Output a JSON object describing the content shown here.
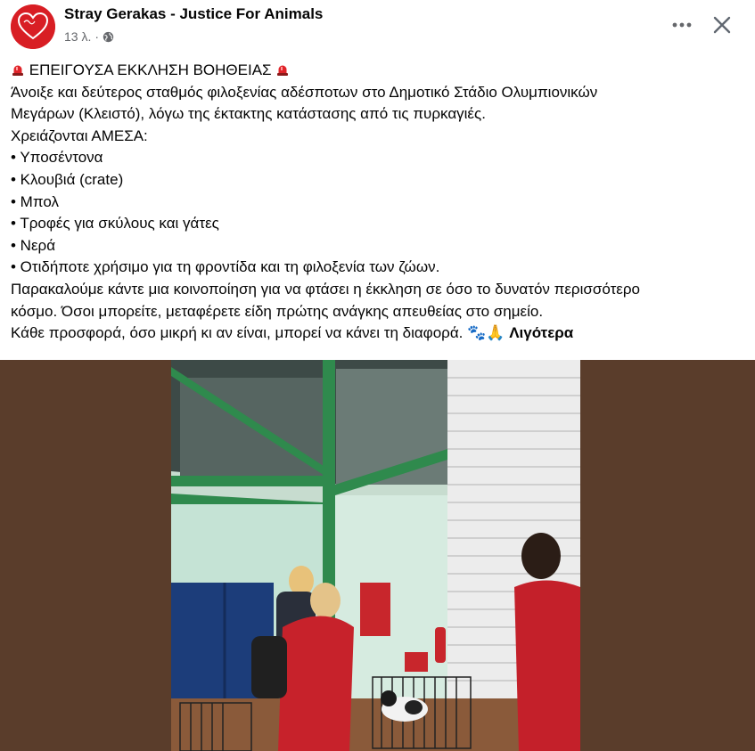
{
  "post": {
    "page_name": "Stray Gerakas - Justice For Animals",
    "timestamp": "13 λ.",
    "separator": "·",
    "audience_icon": "globe-icon",
    "avatar_text": "Stray Gerakas"
  },
  "actions": {
    "more_icon": "more-options-icon",
    "close_icon": "close-icon"
  },
  "body": {
    "lines": [
      "ΕΠΕΙΓΟΥΣΑ ΕΚΚΛΗΣΗ ΒΟΗΘΕΙΑΣ",
      "Άνοιξε και δεύτερος σταθμός φιλοξενίας αδέσποτων στο Δημοτικό Στάδιο Ολυμπιονικών",
      "Μεγάρων (Κλειστό), λόγω της έκτακτης κατάστασης από τις πυρκαγιές.",
      "Χρειάζονται ΑΜΕΣΑ:",
      "• Υποσέντονα",
      "• Κλουβιά (crate)",
      "• Μπολ",
      "• Τροφές για σκύλους και γάτες",
      "• Νερά",
      "• Οτιδήποτε χρήσιμο για τη φροντίδα και τη φιλοξενία των ζώων.",
      "Παρακαλούμε κάντε μια κοινοποίηση για να φτάσει η έκκληση σε όσο το δυνατόν περισσότερο",
      "κόσμο. Όσοι μπορείτε, μεταφέρετε είδη πρώτης ανάγκης απευθείας στο σημείο.",
      "Κάθε προσφορά, όσο μικρή κι αν είναι, μπορεί να κάνει τη διαφορά."
    ],
    "emoji_end": "🐾🙏",
    "see_less": "Λιγότερα"
  },
  "colors": {
    "accent_red": "#d81e24",
    "media_bg": "#5a3d2b",
    "meta_gray": "#65676b"
  }
}
